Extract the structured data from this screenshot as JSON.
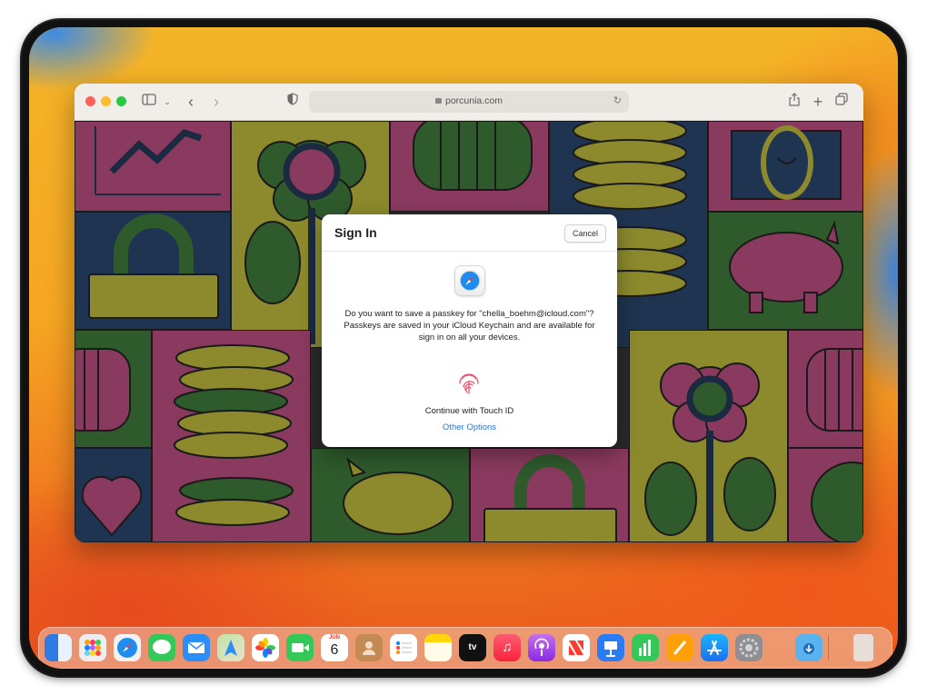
{
  "browser": {
    "url": "porcunia.com",
    "toolbar_icons": [
      "sidebar-icon",
      "chevron-down-icon",
      "back-icon",
      "forward-icon",
      "privacy-shield-icon",
      "reload-icon",
      "share-icon",
      "new-tab-icon",
      "tab-overview-icon"
    ]
  },
  "dialog": {
    "title": "Sign In",
    "cancel_label": "Cancel",
    "message": "Do you want to save a passkey for \"chella_boehm@icloud.com\"? Passkeys are saved in your iCloud Keychain and are available for sign in on all your devices.",
    "continue_label": "Continue with Touch ID",
    "other_options_label": "Other Options"
  },
  "dock": {
    "calendar_month": "JUN",
    "calendar_day": "6",
    "apple_tv_label": "tv",
    "apps": [
      "Finder",
      "Launchpad",
      "Safari",
      "Messages",
      "Mail",
      "Maps",
      "Photos",
      "FaceTime",
      "Calendar",
      "Contacts",
      "Reminders",
      "Notes",
      "TV",
      "Music",
      "Podcasts",
      "News",
      "Keynote",
      "Numbers",
      "Pages",
      "App Store",
      "System Settings",
      "Downloads",
      "Trash"
    ]
  },
  "colors": {
    "accent_link": "#2a72d8",
    "tile_magenta": "#8a3a5e",
    "tile_olive": "#8c8a2c",
    "tile_green": "#3a6a35",
    "tile_navy": "#1f3450"
  }
}
